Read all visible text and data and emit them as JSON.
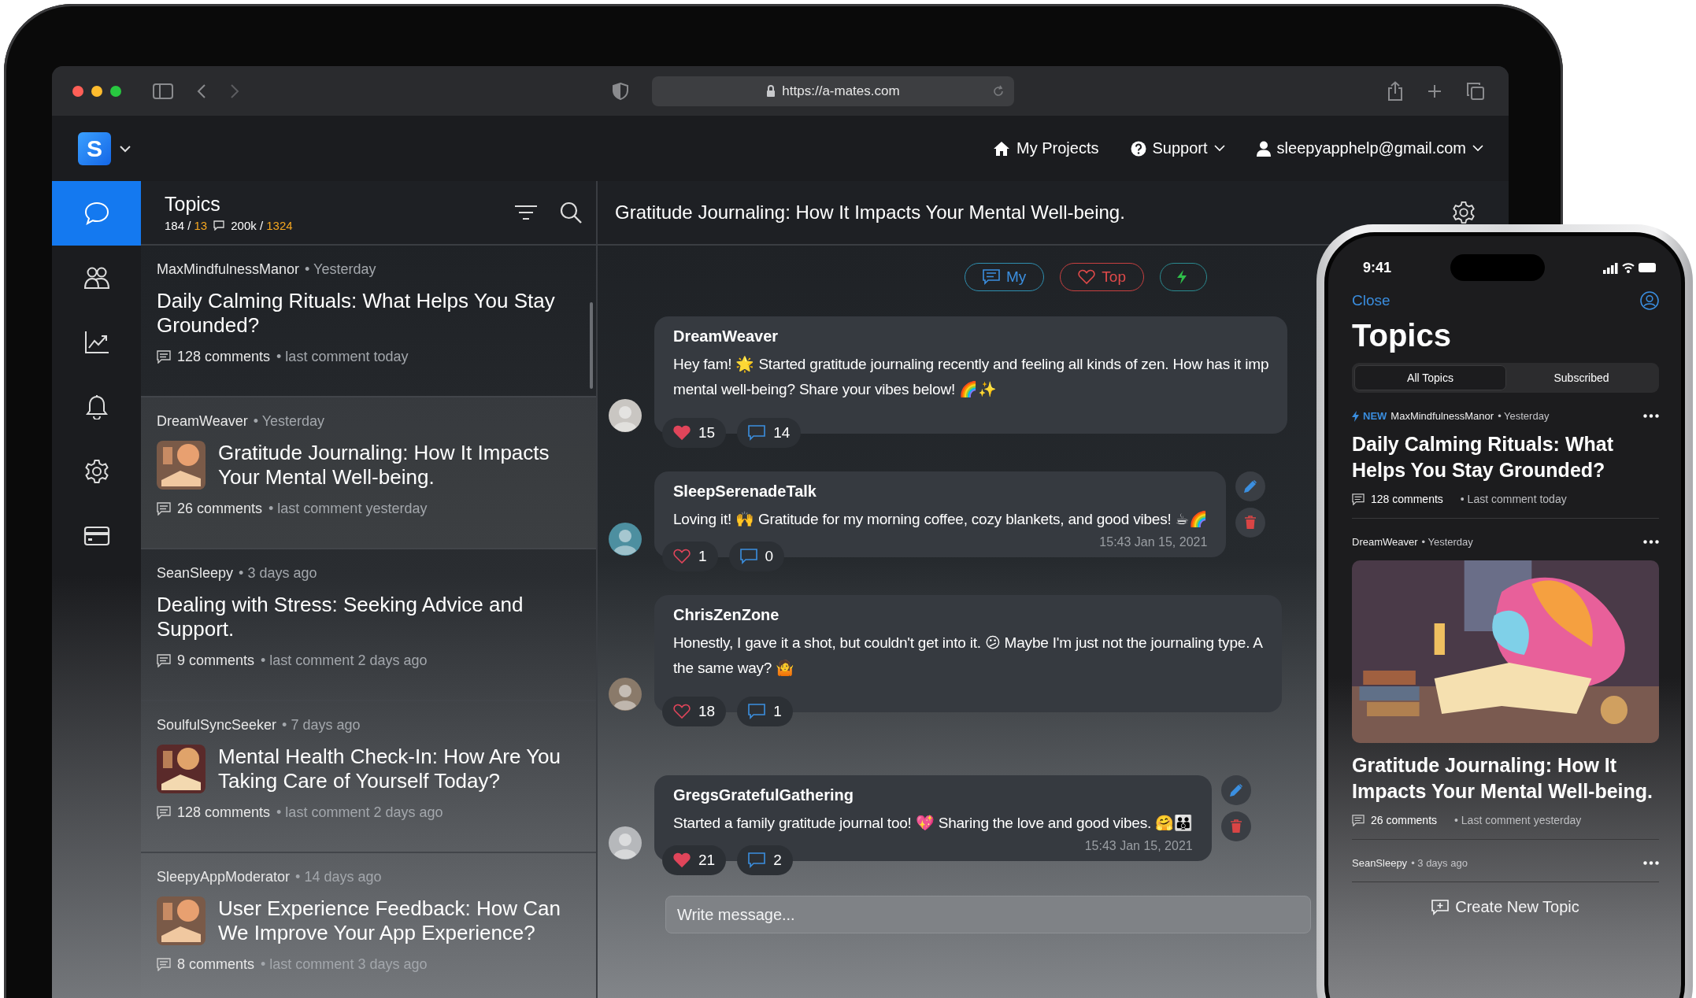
{
  "browser": {
    "url": "https://a-mates.com"
  },
  "app_header": {
    "logo": "S",
    "nav": [
      {
        "label": "My Projects",
        "kind": "home",
        "has_menu": false
      },
      {
        "label": "Support",
        "kind": "help",
        "has_menu": true
      },
      {
        "label": "sleepyapphelp@gmail.com",
        "kind": "user",
        "has_menu": true
      }
    ]
  },
  "sidebar": {
    "items": [
      {
        "kind": "chat",
        "selected": true
      },
      {
        "kind": "people",
        "selected": false
      },
      {
        "kind": "chart",
        "selected": false
      },
      {
        "kind": "bell",
        "selected": false
      },
      {
        "kind": "settings",
        "selected": false
      },
      {
        "kind": "card",
        "selected": false
      }
    ]
  },
  "topics_panel": {
    "title": "Topics",
    "topics_count": "184 /",
    "topics_new": "13",
    "comments_count": "200k /",
    "comments_new": "1324",
    "topics": [
      {
        "author": "MaxMindfulnessManor",
        "time": "• Yesterday",
        "title": "Daily Calming Rituals: What Helps You Stay Grounded?",
        "comments": "128 comments",
        "last_comment": "• last comment today",
        "picture": false,
        "selected": false
      },
      {
        "author": "DreamWeaver",
        "time": "• Yesterday",
        "title": "Gratitude Journaling: How It Impacts Your Mental Well-being.",
        "comments": "26 comments",
        "last_comment": "• last comment yesterday",
        "picture": true,
        "selected": true
      },
      {
        "author": "SeanSleepy",
        "time": "• 3 days ago",
        "title": "Dealing with Stress: Seeking Advice and Support.",
        "comments": "9 comments",
        "last_comment": "• last comment 2 days ago",
        "picture": false,
        "selected": false
      },
      {
        "author": "SoulfulSyncSeeker",
        "time": "• 7 days ago",
        "title": "Mental Health Check-In: How Are You Taking Care of Yourself Today?",
        "comments": "128 comments",
        "last_comment": "• last comment 2 days ago",
        "picture": true,
        "selected": false
      },
      {
        "author": "SleepyAppModerator",
        "time": "• 14 days ago",
        "title": "User Experience Feedback: How Can We Improve Your App Experience?",
        "comments": "8 comments",
        "last_comment": "• last comment 3 days ago",
        "picture": true,
        "selected": false
      }
    ]
  },
  "thread": {
    "title": "Gratitude Journaling: How It Impacts Your Mental Well-being.",
    "filters": [
      {
        "kind": "my",
        "label": "My"
      },
      {
        "kind": "top",
        "label": "Top"
      },
      {
        "kind": "new"
      }
    ],
    "messages": [
      {
        "author": "DreamWeaver",
        "lines": [
          "Hey fam! 🌟 Started gratitude journaling recently and feeling all kinds of zen. How has it imp",
          "mental well-being? Share your vibes below! 🌈✨"
        ],
        "likes": "15",
        "liked": true,
        "replies": "14",
        "own": false
      },
      {
        "author": "SleepSerenadeTalk",
        "lines": [
          "Loving it! 🙌 Gratitude for my morning coffee, cozy blankets, and good vibes! ☕🌈"
        ],
        "time": "15:43 Jan 15, 2021",
        "likes": "1",
        "liked": false,
        "replies": "0",
        "own": true
      },
      {
        "author": "ChrisZenZone",
        "lines": [
          "Honestly, I gave it a shot, but couldn't get into it. 😕 Maybe I'm just not the journaling type. A",
          "the same way? 🤷"
        ],
        "likes": "18",
        "liked": false,
        "replies": "1",
        "own": false
      },
      {
        "author": "GregsGratefulGathering",
        "lines": [
          "Started a family gratitude journal too! 💖 Sharing the love and good vibes. 🤗👪"
        ],
        "time": "15:43 Jan 15, 2021",
        "likes": "21",
        "liked": true,
        "replies": "2",
        "own": true
      }
    ],
    "composer": {
      "placeholder": "Write message..."
    }
  },
  "phone": {
    "time": "9:41",
    "close": "Close",
    "title": "Topics",
    "segments": [
      {
        "label": "All Topics",
        "selected": true
      },
      {
        "label": "Subscribed",
        "selected": false
      }
    ],
    "topics": [
      {
        "badge": "NEW",
        "author": "MaxMindfulnessManor",
        "time": "• Yesterday",
        "title": "Daily Calming Rituals: What Helps You Stay Grounded?",
        "comments": "128 comments",
        "last_comment": "• Last comment today"
      },
      {
        "author": "DreamWeaver",
        "time": "• Yesterday",
        "kind": "picture",
        "title": "Gratitude Journaling: How It Impacts Your Mental Well-being.",
        "comments": "26 comments",
        "last_comment": "• Last comment yesterday"
      },
      {
        "author": "SeanSleepy",
        "time": "• 3 days ago"
      }
    ],
    "create_button": "Create New Topic"
  }
}
